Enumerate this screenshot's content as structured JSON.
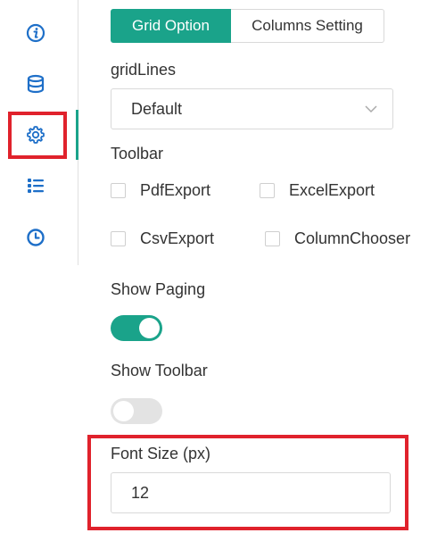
{
  "sidebar": {
    "items": [
      {
        "icon": "info-icon"
      },
      {
        "icon": "database-icon"
      },
      {
        "icon": "gear-icon",
        "active": true
      },
      {
        "icon": "list-icon"
      },
      {
        "icon": "clock-icon"
      }
    ]
  },
  "tabs": [
    {
      "label": "Grid Option",
      "active": true
    },
    {
      "label": "Columns Setting",
      "active": false
    }
  ],
  "grid_lines": {
    "label": "gridLines",
    "selected": "Default"
  },
  "toolbar": {
    "label": "Toolbar",
    "options": [
      {
        "label": "PdfExport",
        "checked": false
      },
      {
        "label": "ExcelExport",
        "checked": false
      },
      {
        "label": "CsvExport",
        "checked": false
      },
      {
        "label": "ColumnChooser",
        "checked": false
      }
    ]
  },
  "show_paging": {
    "label": "Show Paging",
    "enabled": true
  },
  "show_toolbar": {
    "label": "Show Toolbar",
    "enabled": false
  },
  "font_size": {
    "label": "Font Size (px)",
    "value": "12"
  },
  "colors": {
    "accent": "#1aa38a",
    "highlight": "#e0222c"
  }
}
